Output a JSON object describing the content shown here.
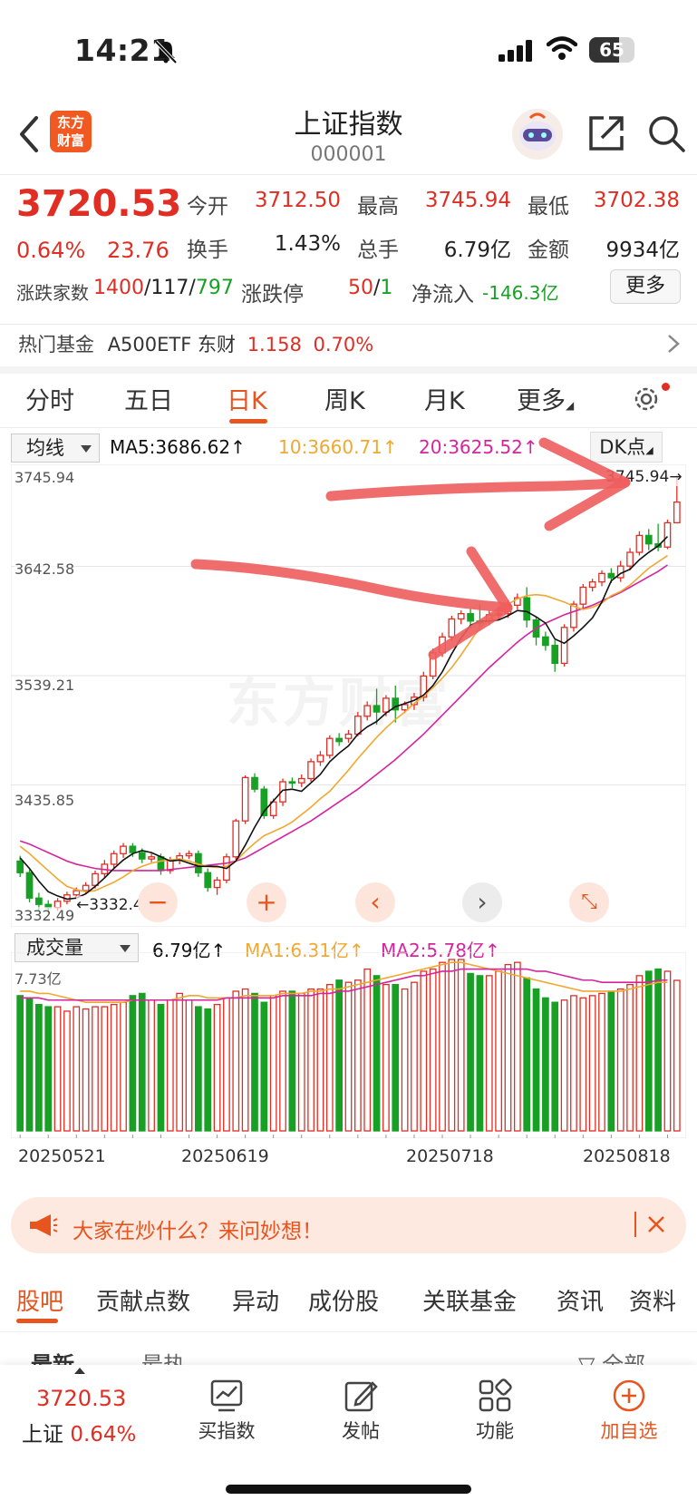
{
  "status_bar": {
    "time": "14:21",
    "battery": "65"
  },
  "header": {
    "title": "上证指数",
    "code": "000001",
    "logo_text_1": "东方",
    "logo_text_2": "财富"
  },
  "quote": {
    "price": "3720.53",
    "pct": "0.64%",
    "change": "23.76",
    "fields": [
      {
        "label": "今开",
        "value": "3712.50",
        "color": "red"
      },
      {
        "label": "最高",
        "value": "3745.94",
        "color": "red"
      },
      {
        "label": "最低",
        "value": "3702.38",
        "color": "red"
      },
      {
        "label": "换手",
        "value": "1.43%",
        "color": "black"
      },
      {
        "label": "总手",
        "value": "6.79亿",
        "color": "black"
      },
      {
        "label": "金额",
        "value": "9934亿",
        "color": "black"
      }
    ],
    "breadth_label": "涨跌家数",
    "breadth_up": "1400",
    "breadth_flat": "117",
    "breadth_down": "797",
    "limit_label": "涨跌停",
    "limit_up": "50",
    "limit_down": "1",
    "netflow_label": "净流入",
    "netflow_value": "-146.3亿",
    "more_label": "更多"
  },
  "hot_fund": {
    "label": "热门基金",
    "name": "A500ETF 东财",
    "price": "1.158",
    "pct": "0.70%"
  },
  "chart_tabs": [
    "分时",
    "五日",
    "日K",
    "周K",
    "月K",
    "更多"
  ],
  "active_tab": "日K",
  "ma": {
    "select": "均线",
    "ma5": "MA5:3686.62",
    "ma10": "10:3660.71",
    "ma20": "20:3625.52",
    "dk": "DK点"
  },
  "kline_axis": [
    "3745.94",
    "3642.58",
    "3539.21",
    "3435.85",
    "3332.49"
  ],
  "kline_high_label": "3745.94",
  "kline_low_label": "3332.49",
  "watermark": "东方财富",
  "volume": {
    "select": "成交量",
    "value": "6.79亿",
    "ma1": "MA1:6.31亿",
    "ma2": "MA2:5.78亿",
    "axis_top": "7.73亿"
  },
  "dates": [
    "20250521",
    "20250619",
    "20250718",
    "20250818"
  ],
  "chart_data": {
    "type": "candlestick",
    "ylim": [
      3332.49,
      3745.94
    ],
    "candles": [
      [
        3381,
        3370,
        3386,
        3366
      ],
      [
        3370,
        3346,
        3373,
        3342
      ],
      [
        3346,
        3340,
        3351,
        3334
      ],
      [
        3340,
        3337,
        3344,
        3332
      ],
      [
        3337,
        3343,
        3346,
        3334
      ],
      [
        3343,
        3349,
        3352,
        3340
      ],
      [
        3349,
        3353,
        3356,
        3345
      ],
      [
        3353,
        3358,
        3361,
        3350
      ],
      [
        3358,
        3369,
        3372,
        3355
      ],
      [
        3369,
        3378,
        3382,
        3365
      ],
      [
        3378,
        3388,
        3391,
        3374
      ],
      [
        3388,
        3395,
        3398,
        3384
      ],
      [
        3395,
        3389,
        3398,
        3385
      ],
      [
        3389,
        3383,
        3393,
        3379
      ],
      [
        3383,
        3385,
        3388,
        3380
      ],
      [
        3385,
        3372,
        3388,
        3368
      ],
      [
        3372,
        3382,
        3385,
        3369
      ],
      [
        3382,
        3386,
        3389,
        3378
      ],
      [
        3386,
        3388,
        3391,
        3383
      ],
      [
        3388,
        3370,
        3391,
        3366
      ],
      [
        3370,
        3356,
        3374,
        3352
      ],
      [
        3356,
        3363,
        3366,
        3349
      ],
      [
        3363,
        3385,
        3388,
        3360
      ],
      [
        3385,
        3419,
        3421,
        3382
      ],
      [
        3419,
        3460,
        3462,
        3416
      ],
      [
        3460,
        3449,
        3464,
        3446
      ],
      [
        3449,
        3424,
        3452,
        3421
      ],
      [
        3424,
        3437,
        3440,
        3421
      ],
      [
        3437,
        3456,
        3459,
        3433
      ],
      [
        3456,
        3455,
        3460,
        3450
      ],
      [
        3455,
        3459,
        3463,
        3451
      ],
      [
        3459,
        3475,
        3478,
        3456
      ],
      [
        3475,
        3481,
        3485,
        3471
      ],
      [
        3481,
        3497,
        3500,
        3478
      ],
      [
        3497,
        3494,
        3502,
        3490
      ],
      [
        3497,
        3501,
        3505,
        3493
      ],
      [
        3501,
        3518,
        3522,
        3499
      ],
      [
        3518,
        3528,
        3532,
        3514
      ],
      [
        3528,
        3522,
        3544,
        3510
      ],
      [
        3522,
        3535,
        3538,
        3518
      ],
      [
        3535,
        3524,
        3547,
        3512
      ],
      [
        3524,
        3529,
        3532,
        3521
      ],
      [
        3529,
        3536,
        3540,
        3524
      ],
      [
        3536,
        3556,
        3560,
        3532
      ],
      [
        3556,
        3578,
        3582,
        3553
      ],
      [
        3578,
        3593,
        3597,
        3574
      ],
      [
        3593,
        3610,
        3613,
        3589
      ],
      [
        3610,
        3615,
        3618,
        3605
      ],
      [
        3615,
        3608,
        3620,
        3601
      ],
      [
        3608,
        3606,
        3624,
        3602
      ],
      [
        3608,
        3614,
        3618,
        3604
      ],
      [
        3614,
        3615,
        3622,
        3610
      ],
      [
        3615,
        3623,
        3628,
        3611
      ],
      [
        3623,
        3630,
        3634,
        3619
      ],
      [
        3630,
        3609,
        3640,
        3602
      ],
      [
        3609,
        3593,
        3612,
        3585
      ],
      [
        3593,
        3585,
        3598,
        3580
      ],
      [
        3585,
        3568,
        3590,
        3560
      ],
      [
        3568,
        3602,
        3605,
        3565
      ],
      [
        3602,
        3624,
        3627,
        3598
      ],
      [
        3624,
        3640,
        3643,
        3620
      ],
      [
        3640,
        3645,
        3648,
        3636
      ],
      [
        3645,
        3653,
        3656,
        3641
      ],
      [
        3653,
        3649,
        3658,
        3644
      ],
      [
        3649,
        3660,
        3665,
        3645
      ],
      [
        3660,
        3673,
        3677,
        3656
      ],
      [
        3673,
        3689,
        3693,
        3670
      ],
      [
        3689,
        3681,
        3695,
        3675
      ],
      [
        3681,
        3678,
        3700,
        3674
      ],
      [
        3678,
        3701,
        3704,
        3676
      ],
      [
        3701,
        3720.53,
        3745.94,
        3702.38
      ]
    ],
    "ma5": [
      3384,
      3374,
      3362,
      3352,
      3348,
      3345,
      3346,
      3350,
      3357,
      3365,
      3374,
      3382,
      3388,
      3391,
      3389,
      3385,
      3381,
      3382,
      3379,
      3376,
      3376,
      3376,
      3374,
      3381,
      3396,
      3413,
      3428,
      3438,
      3448,
      3449,
      3447,
      3455,
      3463,
      3475,
      3483,
      3490,
      3501,
      3508,
      3513,
      3521,
      3527,
      3530,
      3533,
      3538,
      3547,
      3560,
      3577,
      3592,
      3604,
      3608,
      3608,
      3609,
      3613,
      3618,
      3617,
      3612,
      3606,
      3591,
      3587,
      3594,
      3602,
      3611,
      3626,
      3646,
      3653,
      3657,
      3666,
      3673,
      3679,
      3688,
      3686.62
    ],
    "ma10": [
      3395,
      3388,
      3380,
      3372,
      3364,
      3357,
      3354,
      3352,
      3353,
      3357,
      3361,
      3366,
      3372,
      3376,
      3379,
      3381,
      3382,
      3383,
      3381,
      3378,
      3376,
      3375,
      3376,
      3381,
      3390,
      3398,
      3405,
      3409,
      3413,
      3418,
      3425,
      3432,
      3440,
      3447,
      3457,
      3467,
      3478,
      3488,
      3498,
      3507,
      3515,
      3522,
      3530,
      3537,
      3545,
      3554,
      3564,
      3576,
      3589,
      3602,
      3610,
      3617,
      3624,
      3629,
      3632,
      3633,
      3632,
      3629,
      3626,
      3622,
      3619,
      3621,
      3625,
      3632,
      3636,
      3642,
      3650,
      3658,
      3664,
      3670,
      3660.71
    ],
    "ma20": [
      3400,
      3397,
      3393,
      3389,
      3385,
      3381,
      3378,
      3376,
      3374,
      3373,
      3372,
      3372,
      3372,
      3372,
      3372,
      3372,
      3373,
      3374,
      3375,
      3376,
      3377,
      3378,
      3379,
      3381,
      3384,
      3389,
      3394,
      3399,
      3404,
      3409,
      3414,
      3419,
      3425,
      3431,
      3437,
      3443,
      3449,
      3456,
      3463,
      3470,
      3477,
      3485,
      3493,
      3501,
      3510,
      3519,
      3528,
      3537,
      3546,
      3555,
      3564,
      3572,
      3580,
      3588,
      3595,
      3601,
      3606,
      3610,
      3614,
      3617,
      3620,
      3623,
      3627,
      3631,
      3635,
      3640,
      3645,
      3650,
      3655,
      3661,
      3625.52
    ],
    "volume": [
      6.1,
      6.0,
      5.7,
      5.6,
      5.6,
      5.4,
      5.6,
      5.5,
      5.6,
      5.6,
      5.7,
      5.8,
      6.1,
      6.2,
      5.9,
      5.7,
      5.9,
      6.2,
      5.9,
      5.6,
      5.5,
      5.7,
      6.0,
      6.3,
      6.4,
      6.2,
      5.8,
      6.1,
      6.3,
      6.3,
      6.2,
      6.4,
      6.4,
      6.6,
      6.8,
      6.7,
      6.8,
      7.3,
      7.0,
      6.6,
      6.6,
      6.4,
      6.7,
      7.2,
      7.3,
      7.6,
      7.73,
      7.73,
      7.1,
      7.0,
      7.0,
      7.2,
      7.5,
      7.6,
      6.9,
      6.4,
      6.0,
      5.8,
      5.9,
      6.1,
      6.0,
      6.1,
      6.2,
      6.3,
      6.4,
      6.6,
      7.0,
      7.2,
      7.3,
      7.2,
      6.79
    ],
    "vol_ma1": [
      6.3,
      6.3,
      6.2,
      6.2,
      6.1,
      6.0,
      5.9,
      5.8,
      5.8,
      5.8,
      5.8,
      5.8,
      5.9,
      5.9,
      5.9,
      5.9,
      5.9,
      6.0,
      6.1,
      6.1,
      6.0,
      6.0,
      6.0,
      6.0,
      6.1,
      6.1,
      6.1,
      6.1,
      6.2,
      6.2,
      6.2,
      6.3,
      6.3,
      6.4,
      6.4,
      6.5,
      6.6,
      6.7,
      6.8,
      6.9,
      7.0,
      7.1,
      7.2,
      7.3,
      7.4,
      7.5,
      7.6,
      7.6,
      7.5,
      7.4,
      7.3,
      7.2,
      7.1,
      7.0,
      6.9,
      6.8,
      6.7,
      6.6,
      6.5,
      6.4,
      6.3,
      6.3,
      6.3,
      6.3,
      6.3,
      6.4,
      6.5,
      6.6,
      6.7,
      6.7,
      6.31
    ],
    "vol_ma2": [
      6.0,
      6.0,
      6.0,
      5.9,
      5.9,
      5.9,
      5.9,
      5.9,
      5.9,
      5.9,
      5.9,
      5.9,
      5.9,
      5.9,
      5.9,
      5.9,
      5.9,
      5.9,
      5.9,
      5.9,
      5.9,
      5.9,
      6.0,
      6.0,
      6.0,
      6.0,
      6.0,
      6.0,
      6.1,
      6.1,
      6.1,
      6.1,
      6.2,
      6.2,
      6.3,
      6.3,
      6.4,
      6.5,
      6.6,
      6.7,
      6.8,
      6.9,
      7.0,
      7.0,
      7.1,
      7.2,
      7.2,
      7.3,
      7.3,
      7.3,
      7.3,
      7.3,
      7.3,
      7.3,
      7.3,
      7.2,
      7.2,
      7.1,
      7.0,
      6.9,
      6.8,
      6.8,
      6.7,
      6.7,
      6.7,
      6.7,
      6.7,
      6.7,
      6.8,
      6.8,
      5.78
    ],
    "vol_ylim": [
      0,
      7.73
    ]
  },
  "banner": {
    "text": "大家在炒什么？来问妙想！"
  },
  "bottom_tabs": [
    "股吧",
    "贡献点数",
    "异动",
    "成份股",
    "关联基金",
    "资讯",
    "资料"
  ],
  "sub_tabs": {
    "latest": "最新",
    "hot": "最热",
    "filter": "全部"
  },
  "bottom_bar": {
    "price": "3720.53",
    "name": "上证",
    "pct": "0.64%",
    "items": [
      "买指数",
      "发帖",
      "功能",
      "加自选"
    ]
  },
  "colors": {
    "up": "#e02e24",
    "down": "#18a025",
    "accent": "#e8541e",
    "ma5": "#111111",
    "ma10": "#f0a830",
    "ma20": "#d6249f"
  }
}
